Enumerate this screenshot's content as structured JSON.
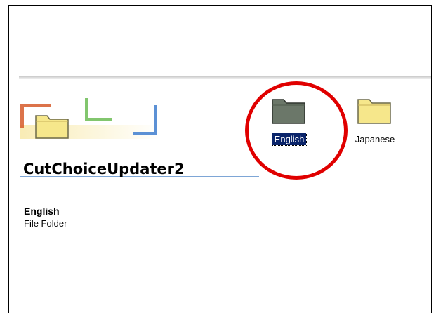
{
  "window": {
    "folder_title": "CutChoiceUpdater2"
  },
  "details": {
    "selected_name": "English",
    "selected_type": "File Folder"
  },
  "folders": [
    {
      "label": "English",
      "icon": "folder-icon",
      "state": "selected"
    },
    {
      "label": "Japanese",
      "icon": "folder-icon",
      "state": "normal"
    }
  ],
  "annotation": {
    "circle_color": "#e00000",
    "target": "English"
  },
  "colors": {
    "selection": "#0a246a",
    "folder_yellow": "#f6e78b",
    "selected_folder": "#6b7769",
    "accent_blue": "#7ea6d6"
  }
}
